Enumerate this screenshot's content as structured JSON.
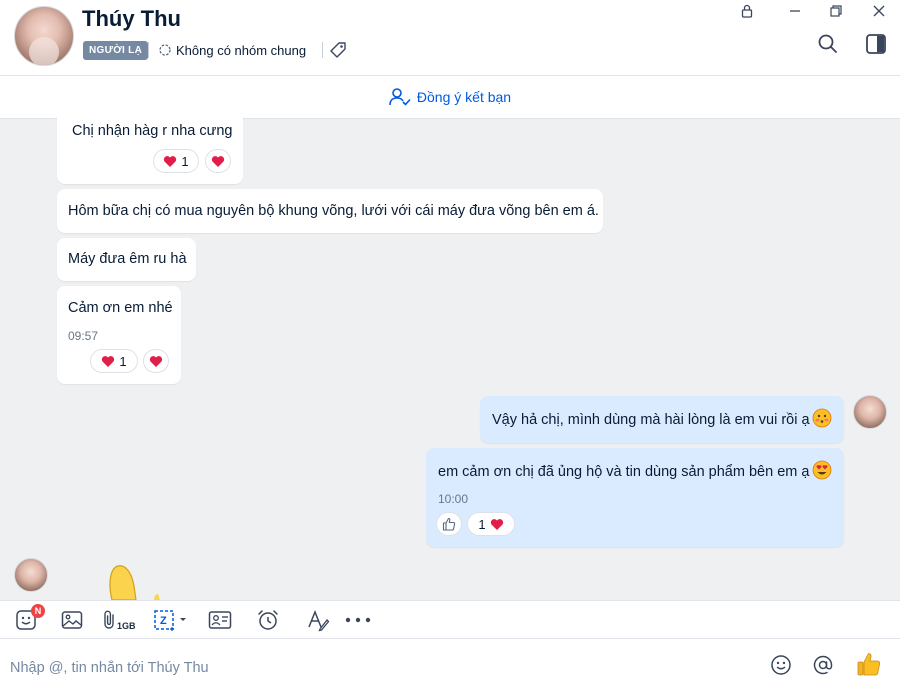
{
  "header": {
    "name": "Thúy Thu",
    "badge": "NGƯỜI LẠ",
    "groups": "Không có nhóm chung"
  },
  "friend_request": {
    "label": "Đồng ý kết bạn"
  },
  "messages": [
    {
      "sender": "contact",
      "text": "Chị nhận hàg r nha cưng",
      "reaction_count": "1"
    },
    {
      "sender": "contact",
      "text": "Hôm bữa chị có mua nguyên bộ khung võng, lưới với cái máy đưa võng bên em á."
    },
    {
      "sender": "contact",
      "text": "Máy đưa êm ru hà"
    },
    {
      "sender": "contact",
      "text": "Cảm ơn em nhé",
      "time": "09:57",
      "reaction_count": "1"
    },
    {
      "sender": "me",
      "text": "Vậy hả chị, mình dùng mà hài lòng là em vui rồi ạ",
      "emoji": "blushing-face"
    },
    {
      "sender": "me",
      "text": "em cảm ơn chị đã ủng hộ và tin dùng sản phẩm bên em ạ",
      "emoji": "heart-eyes-face",
      "time": "10:00",
      "reaction_count": "1"
    }
  ],
  "toolbar": {
    "sticker_badge": "N",
    "file_size_label": "1GB",
    "items": [
      "sticker-icon",
      "image-icon",
      "attachment-icon",
      "screenshot-icon",
      "contact-card-icon",
      "reminder-icon",
      "format-text-icon",
      "more-icon"
    ]
  },
  "composer": {
    "placeholder": "Nhập @, tin nhắn tới Thúy Thu"
  },
  "colors": {
    "accent": "#005ae0",
    "my_bubble": "#dbebff",
    "badge": "#7589a3",
    "heart": "#e11d48"
  }
}
